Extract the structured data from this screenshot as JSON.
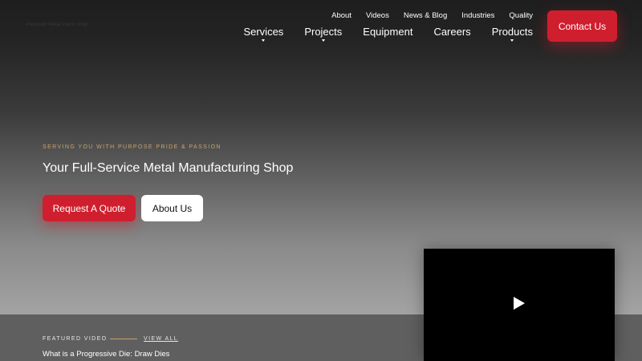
{
  "header": {
    "logo_text": "Precision Metal Parts Shop",
    "utility_nav": [
      "About",
      "Videos",
      "News & Blog",
      "Industries",
      "Quality"
    ],
    "main_nav": [
      "Services",
      "Projects",
      "Equipment",
      "Careers",
      "Products"
    ],
    "contact_label": "Contact Us"
  },
  "hero": {
    "eyebrow": "SERVING YOU WITH PURPOSE PRIDE & PASSION",
    "headline": "Your Full-Service Metal Manufacturing Shop",
    "quote_button": "Request A Quote",
    "about_button": "About Us"
  },
  "featured": {
    "label": "FEATURED VIDEO",
    "view_all": "VIEW ALL",
    "video_title": "What is a Progressive Die: Draw Dies"
  },
  "colors": {
    "accent_red": "#cf1f2e",
    "accent_gold": "#c9a46a"
  },
  "icons": {
    "video_play": "play-icon",
    "nav_caret": "caret-down-icon"
  }
}
